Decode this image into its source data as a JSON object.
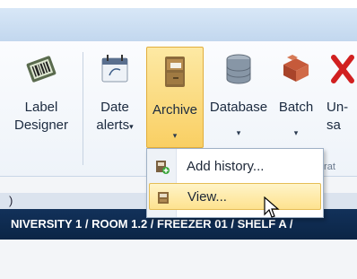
{
  "ribbon": {
    "buttons": [
      {
        "label_line1": "Label",
        "label_line2": "Designer",
        "icon": "barcode-label-icon",
        "has_dropdown": false
      },
      {
        "label_line1": "Date",
        "label_line2": "alerts",
        "icon": "calendar-icon",
        "has_dropdown": true
      },
      {
        "label_line1": "Archive",
        "label_line2": "",
        "icon": "filing-cabinet-icon",
        "has_dropdown": true,
        "active": true
      },
      {
        "label_line1": "Database",
        "label_line2": "",
        "icon": "database-icon",
        "has_dropdown": true
      },
      {
        "label_line1": "Batch",
        "label_line2": "",
        "icon": "boxes-icon",
        "has_dropdown": true
      },
      {
        "label_line1": "Un-",
        "label_line2": "sa",
        "icon": "unsave-icon",
        "has_dropdown": false
      }
    ],
    "group_label": "trat"
  },
  "dropdown_arrow": "▾",
  "menu": {
    "items": [
      {
        "label": "Add history...",
        "icon": "add-history-icon",
        "highlighted": false
      },
      {
        "label": "View...",
        "icon": "view-archive-icon",
        "highlighted": true
      }
    ]
  },
  "pathbar": {
    "left_fragment": ")",
    "path": "NIVERSITY 1 / ROOM 1.2 / FREEZER 01 / SHELF A /"
  },
  "colors": {
    "title_band": "#c9dcf1",
    "highlight": "#f9cf63",
    "pathbar": "#0f2c52"
  }
}
